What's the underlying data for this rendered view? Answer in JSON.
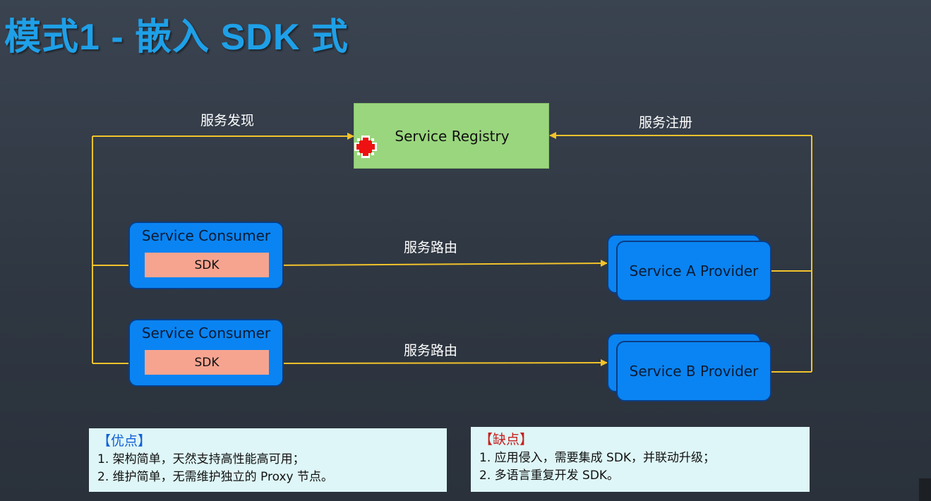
{
  "title": "模式1 - 嵌入 SDK 式",
  "diagram": {
    "registry_label": "Service Registry",
    "discovery_label": "服务发现",
    "register_label": "服务注册",
    "routing_label_1": "服务路由",
    "routing_label_2": "服务路由",
    "consumer_1": {
      "name": "Service Consumer",
      "sdk": "SDK"
    },
    "consumer_2": {
      "name": "Service Consumer",
      "sdk": "SDK"
    },
    "provider_a": "Service A Provider",
    "provider_b": "Service B Provider",
    "colors": {
      "line": "#f2c32b",
      "registry_fill": "#9ad67e",
      "node_fill": "#0a84f2",
      "sdk_fill": "#f6a490",
      "title": "#1ea0e8"
    }
  },
  "pros": {
    "heading": "【优点】",
    "items": [
      "1. 架构简单，天然支持高性能高可用；",
      "2. 维护简单，无需维护独立的 Proxy 节点。"
    ]
  },
  "cons": {
    "heading": "【缺点】",
    "items": [
      "1.  应用侵入，需要集成 SDK，并联动升级；",
      "2.  多语言重复开发 SDK。"
    ]
  }
}
